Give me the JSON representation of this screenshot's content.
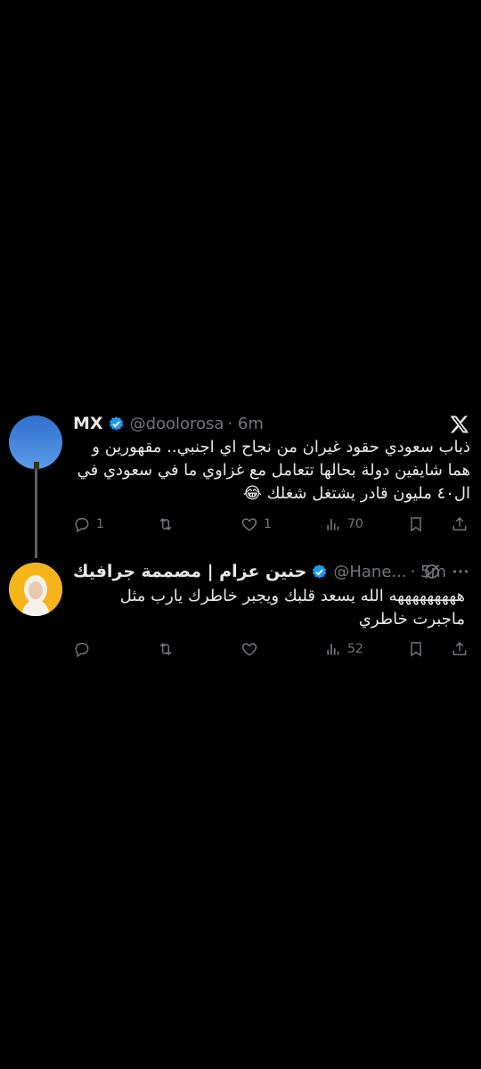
{
  "tweet1": {
    "name": "MX",
    "handle": "@doolorosa",
    "time": "· 6m",
    "text": "ذباب سعودي حقود غيران من نجاح اي اجنبي.. مقهورين و هما شايفين دولة بحالها تتعامل مع غزاوي ما في سعودي في ال٤٠ مليون قادر يشتغل شغلك 😂",
    "retweets": "",
    "replies": "1",
    "likes": "1",
    "views": "70"
  },
  "tweet2": {
    "name": "حنين عزام | مصممة جرافيك",
    "handle": "@Hane...",
    "time": "· 5m",
    "text": "هههههههههه الله يسعد قلبك ويجبر خاطرك يارب مثل ماجبرت خاطري",
    "replies": "",
    "likes": "",
    "views": "52"
  },
  "colors": {
    "background": "#000000",
    "text": "#e7e9ea",
    "muted": "#71767b",
    "verified": "#1d9bf0"
  },
  "icons": [
    "x-logo-icon",
    "verified-badge-icon",
    "reply-icon",
    "retweet-icon",
    "like-icon",
    "views-icon",
    "bookmark-icon",
    "share-icon",
    "grok-icon",
    "more-icon"
  ]
}
